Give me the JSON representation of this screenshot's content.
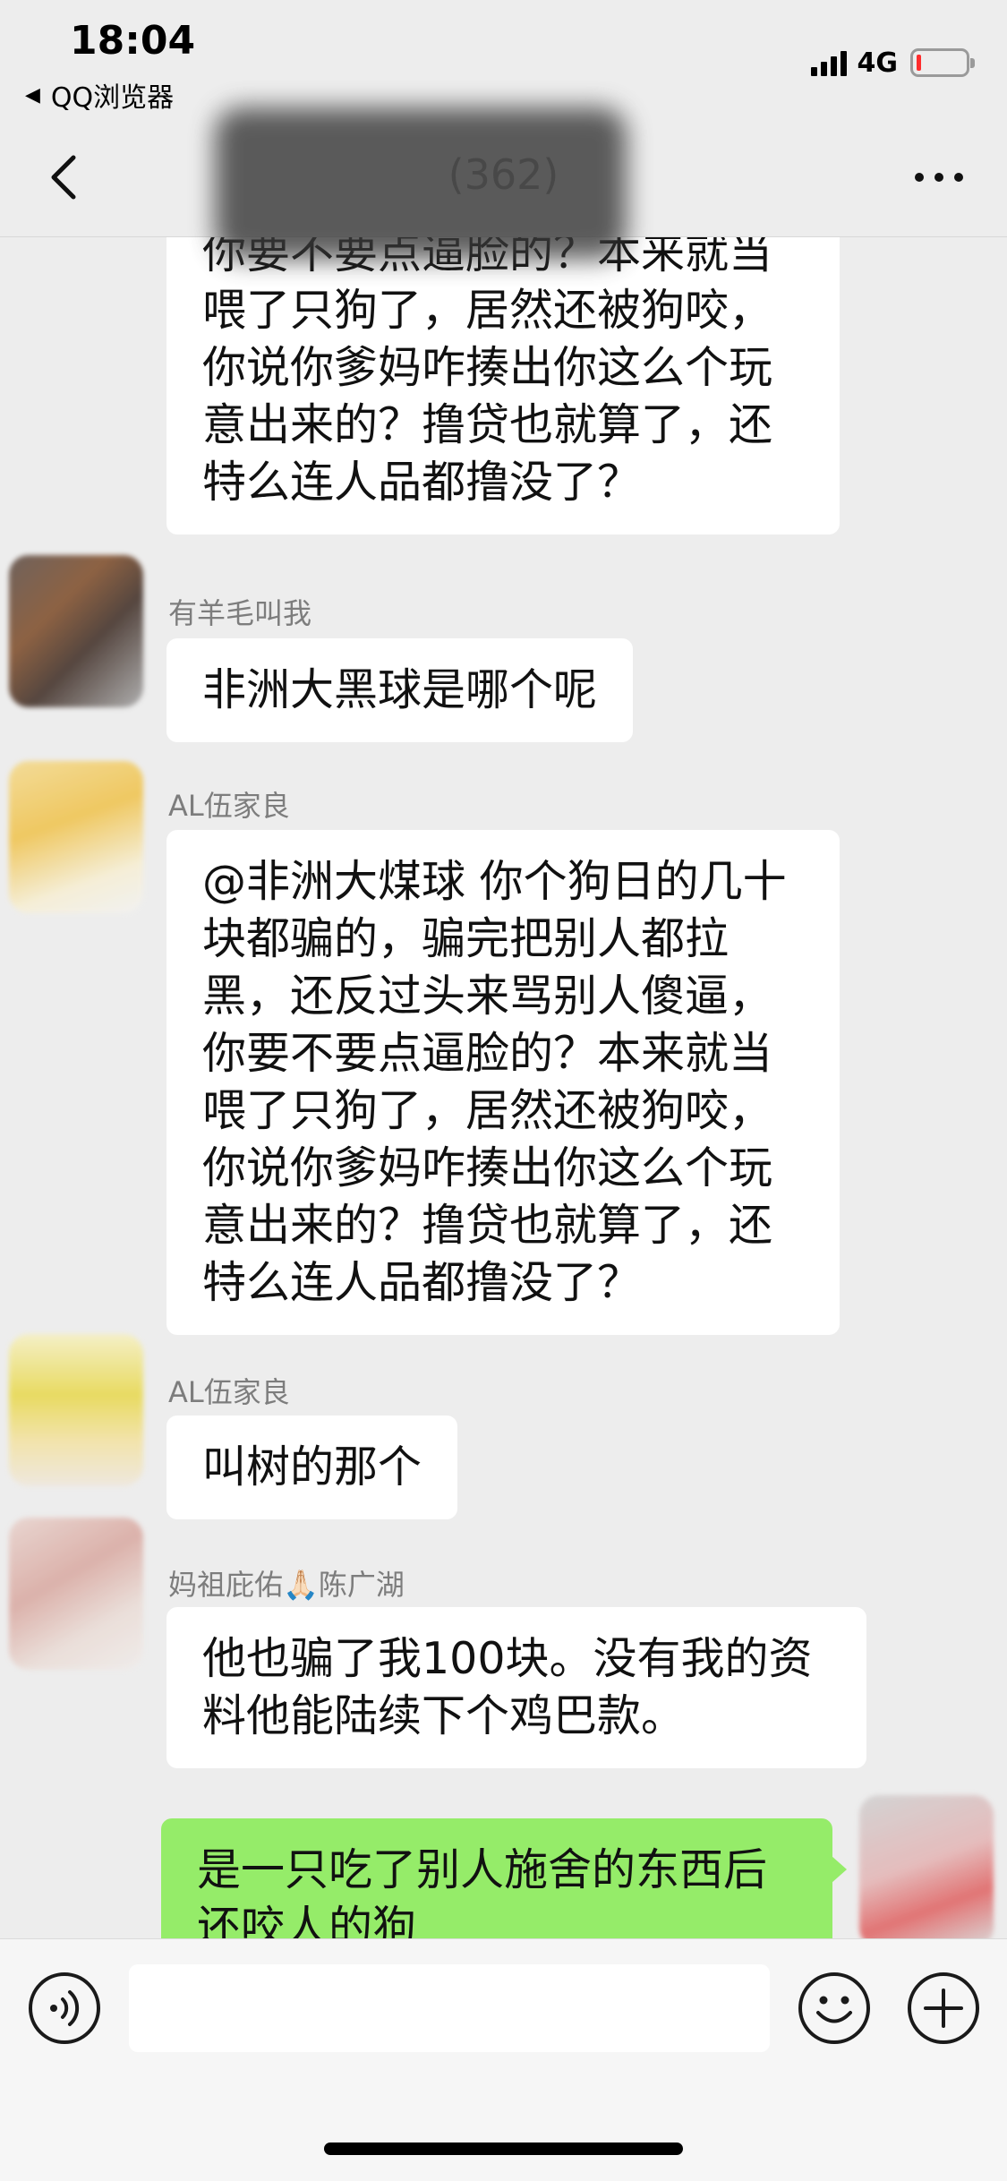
{
  "status_bar": {
    "time": "18:04",
    "back_app": "QQ浏览器",
    "network": "4G",
    "battery_level_percent": 10
  },
  "nav": {
    "title": "(362)",
    "back_icon": "chevron-left-icon",
    "more_icon": "more-dots-icon"
  },
  "messages": [
    {
      "sender": "",
      "lines": [
        "你要不要点逼脸的？本来就当",
        "喂了只狗了，居然还被狗咬，",
        "你说你爹妈咋揍出你这么个玩",
        "意出来的？撸贷也就算了，还",
        "特么连人品都撸没了？"
      ]
    },
    {
      "sender": "有羊毛叫我",
      "lines": [
        "非洲大黑球是哪个呢"
      ]
    },
    {
      "sender": "AL伍家良",
      "lines": [
        "@非洲大煤球 你个狗日的几十",
        "块都骗的，骗完把别人都拉",
        "黑，还反过头来骂别人傻逼，",
        "你要不要点逼脸的？本来就当",
        "喂了只狗了，居然还被狗咬，",
        "你说你爹妈咋揍出你这么个玩",
        "意出来的？撸贷也就算了，还",
        "特么连人品都撸没了？"
      ]
    },
    {
      "sender": "AL伍家良",
      "lines": [
        "叫树的那个"
      ]
    },
    {
      "sender": "妈祖庇佑🙏🏻陈广湖",
      "lines": [
        "他也骗了我100块。没有我的资",
        "料他能陆续下个鸡巴款。"
      ]
    },
    {
      "sender": "",
      "is_self": true,
      "lines": [
        "是一只吃了别人施舍的东西后",
        "还咬人的狗"
      ]
    }
  ],
  "input_bar": {
    "voice_icon": "voice-icon",
    "input_value": "",
    "emoji_icon": "emoji-icon",
    "plus_icon": "plus-icon"
  },
  "colors": {
    "background": "#ededed",
    "bubble_other": "#ffffff",
    "bubble_self": "#95ec69",
    "battery_low": "#ff2d2d"
  }
}
